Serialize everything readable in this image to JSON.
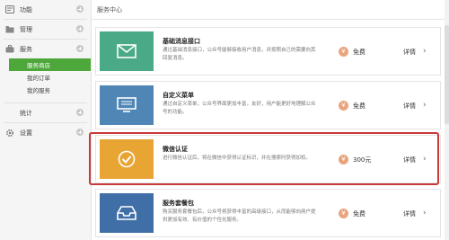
{
  "sidebar": {
    "groups": [
      {
        "label": "功能",
        "icon": "function-icon"
      },
      {
        "label": "管理",
        "icon": "folder-icon"
      },
      {
        "label": "服务",
        "icon": "briefcase-icon"
      }
    ],
    "sub_items": [
      "服务商店",
      "我的订单",
      "我的服务"
    ],
    "groups_after": [
      {
        "label": "统计",
        "icon": "chart-icon"
      },
      {
        "label": "设置",
        "icon": "gear-icon"
      }
    ]
  },
  "header": {
    "title": "服务中心"
  },
  "cards": [
    {
      "title": "基础消息接口",
      "desc": "通过基础消息接口，公众号能够接收用户消息，并按照自己的需要向其回复消息。",
      "price": "免费",
      "detail": "详情",
      "icon": "envelope-icon",
      "color": "#4aaa87"
    },
    {
      "title": "自定义菜单",
      "desc": "通过自定义菜单，公众号界面更加丰富，友好，用户能更好地理解公众号的功能。",
      "price": "免费",
      "detail": "详情",
      "icon": "monitor-icon",
      "color": "#4f86b6"
    },
    {
      "title": "微信认证",
      "desc": "进行微信认证后，将在微信中获得认证标识，并在搜索时获得加权。",
      "price": "300元",
      "detail": "详情",
      "icon": "checkmark-icon",
      "color": "#e8a534"
    },
    {
      "title": "服务套餐包",
      "desc": "购买服务套餐包后，公众号将获得丰富的高级接口，从而能够向用户提供更加有效、有价值的个性化服务。",
      "price": "免费",
      "detail": "详情",
      "icon": "inbox-icon",
      "color": "#3f6fa6"
    }
  ],
  "colors": {
    "active_nav": "#4ea73a",
    "highlight_border": "#c9383a",
    "price_icon": "#e9a47d"
  }
}
